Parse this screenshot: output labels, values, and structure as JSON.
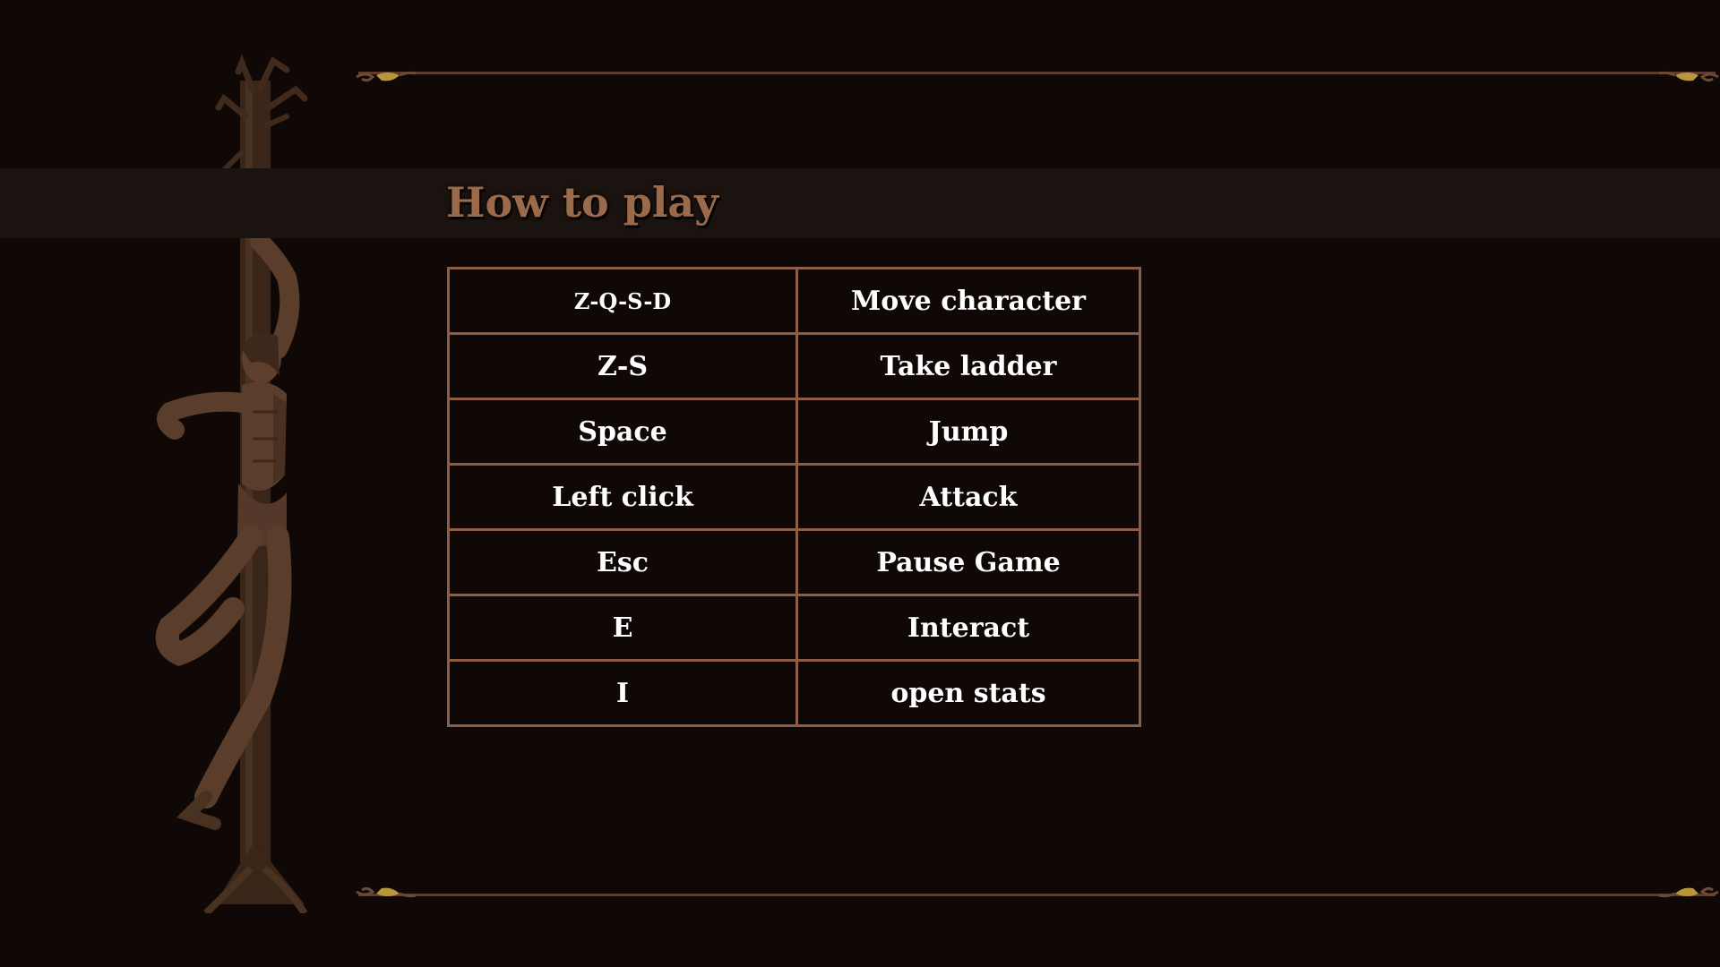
{
  "screen": {
    "title": "How to play"
  },
  "controls": [
    {
      "key": "Z-Q-S-D",
      "action": "Move character"
    },
    {
      "key": "Z-S",
      "action": "Take ladder"
    },
    {
      "key": "Space",
      "action": "Jump"
    },
    {
      "key": "Left click",
      "action": "Attack"
    },
    {
      "key": "Esc",
      "action": "Pause Game"
    },
    {
      "key": "E",
      "action": "Interact"
    },
    {
      "key": "I",
      "action": "open stats"
    }
  ],
  "colors": {
    "background": "#0f0806",
    "title_band": "#1b1310",
    "title_text": "#9a6a4a",
    "table_border": "#8b5e45",
    "frame_line": "#5e3c2e",
    "ornament_gold": "#b8963a"
  },
  "decorations": {
    "statue": "figure-bound-to-dead-tree-statue",
    "corner_ornaments": "gold-leaf-corner-icon"
  }
}
